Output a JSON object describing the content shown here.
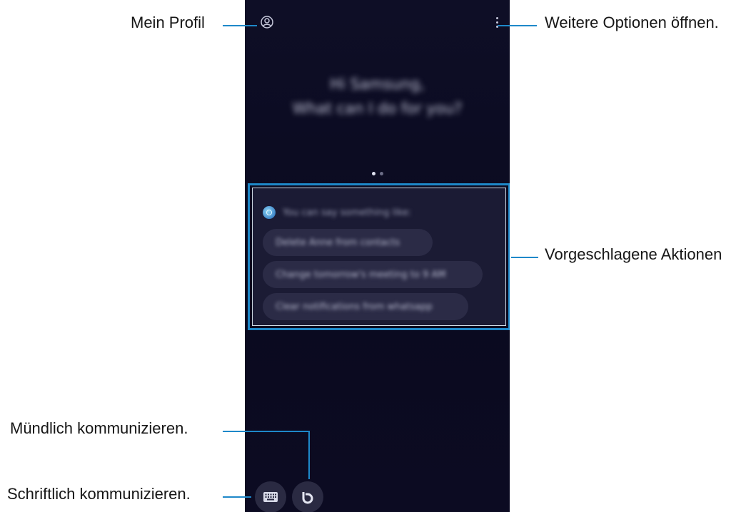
{
  "callouts": {
    "profile": "Mein Profil",
    "more_options": "Weitere Optionen öffnen.",
    "suggested_actions": "Vorgeschlagene Aktionen",
    "voice": "Mündlich kommunizieren.",
    "keyboard": "Schriftlich kommunizieren."
  },
  "screen": {
    "greeting": [
      "Hi Samsung,",
      "What can I do for you?"
    ],
    "page_indicator": {
      "count": 2,
      "active": 1
    },
    "suggestions": {
      "header": "You can say something like:",
      "chips": [
        "Delete Anne from contacts",
        "Change tomorrow's meeting to 9 AM",
        "Clear notifications from whatsapp"
      ]
    },
    "icons": {
      "profile": "person-circle-icon",
      "more": "three-dots-vertical-icon",
      "keyboard": "keyboard-icon",
      "voice": "bixby-b-icon",
      "bixby": "bixby-logo-icon"
    }
  },
  "colors": {
    "accent": "#1e88c9",
    "screen_bg": "#0c0b22",
    "chip_bg": "#2b2b46"
  }
}
